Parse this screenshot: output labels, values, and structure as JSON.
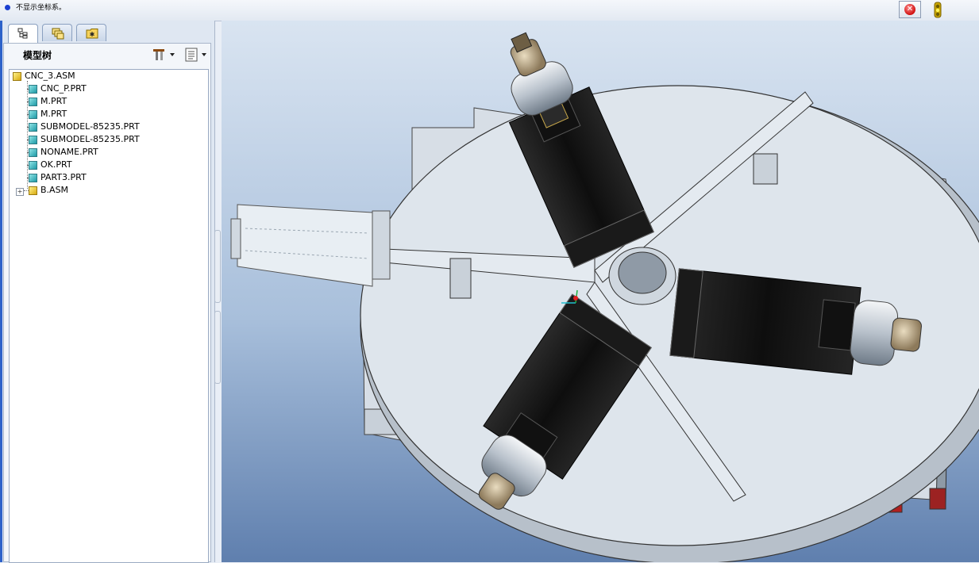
{
  "status_bar": {
    "message": "不显示坐标系。",
    "stop_icon": "stop-icon",
    "light_icon": "traffic-light-icon"
  },
  "navigator": {
    "tabs": [
      {
        "icon": "model-tree-icon",
        "active": true
      },
      {
        "icon": "layers-icon",
        "active": false
      },
      {
        "icon": "folder-browser-icon",
        "active": false
      }
    ],
    "title": "模型树",
    "settings_icon": "tree-settings-icon",
    "show_icon": "tree-show-icon"
  },
  "model_tree": {
    "root": "CNC_3.ASM",
    "items": [
      {
        "label": "CNC_P.PRT",
        "type": "part"
      },
      {
        "label": "M.PRT",
        "type": "part"
      },
      {
        "label": "M.PRT",
        "type": "part"
      },
      {
        "label": "SUBMODEL-85235.PRT",
        "type": "part"
      },
      {
        "label": "SUBMODEL-85235.PRT",
        "type": "part"
      },
      {
        "label": "NONAME.PRT",
        "type": "part"
      },
      {
        "label": "OK.PRT",
        "type": "part"
      },
      {
        "label": "PART3.PRT",
        "type": "part"
      },
      {
        "label": "B.ASM",
        "type": "assembly",
        "expandable": true
      }
    ]
  },
  "colors": {
    "accent": "#2e63c9",
    "model_light": "#dde5ec",
    "motor_black": "#141414"
  }
}
